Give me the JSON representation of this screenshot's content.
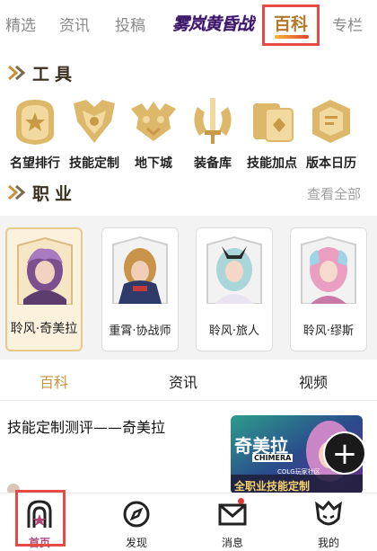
{
  "top_tabs": {
    "items": [
      "精选",
      "资讯",
      "投稿",
      "百科",
      "专栏"
    ],
    "logo_text": "雾岚黄昏战"
  },
  "tools": {
    "title": "工具",
    "items": [
      {
        "label": "名望排行",
        "icon": "trophy-shield-icon"
      },
      {
        "label": "技能定制",
        "icon": "skill-emblem-icon"
      },
      {
        "label": "地下城",
        "icon": "dungeon-icon"
      },
      {
        "label": "装备库",
        "icon": "sword-wings-icon"
      },
      {
        "label": "技能加点",
        "icon": "skill-cards-icon"
      },
      {
        "label": "版本日历",
        "icon": "calendar-book-icon"
      }
    ]
  },
  "classes": {
    "title": "职业",
    "view_all": "查看全部",
    "cards": [
      {
        "name": "聆风·奇美拉",
        "selected": true
      },
      {
        "name": "重霄·协战师",
        "selected": false
      },
      {
        "name": "聆风·旅人",
        "selected": false
      },
      {
        "name": "聆风·缪斯",
        "selected": false
      }
    ]
  },
  "sub_tabs": {
    "items": [
      "百科",
      "资讯",
      "视频"
    ],
    "active": "百科"
  },
  "article": {
    "title": "技能定制测评——奇美拉",
    "thumb_main": "奇美拉",
    "thumb_sub": "CHIMERA",
    "thumb_banner": "全职业技能定制",
    "thumb_badge": "COLG玩家社区"
  },
  "bottom_nav": {
    "items": [
      {
        "label": "首页",
        "icon": "home-arch-icon"
      },
      {
        "label": "发现",
        "icon": "compass-icon"
      },
      {
        "label": "消息",
        "icon": "envelope-icon"
      },
      {
        "label": "我的",
        "icon": "profile-mask-icon"
      }
    ]
  },
  "colors": {
    "accent_gold": "#c8923d",
    "highlight_red": "#e44b45",
    "nav_active": "#b0487a"
  }
}
